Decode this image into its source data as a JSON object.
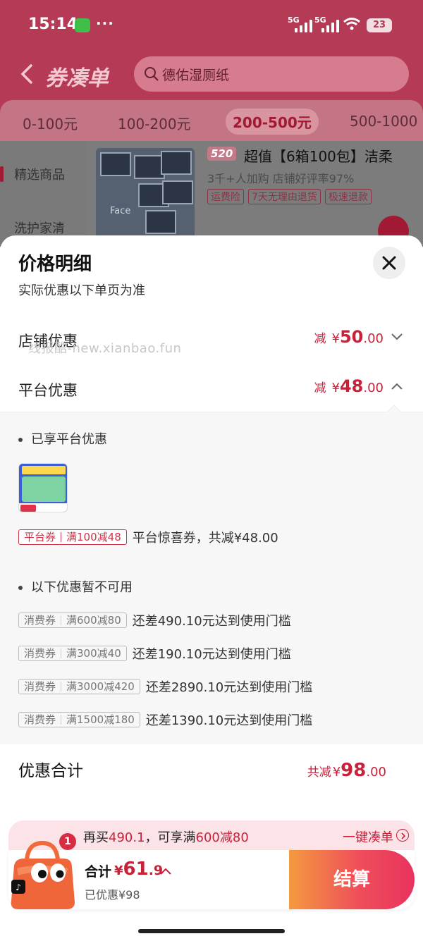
{
  "status_bar": {
    "time": "15:14",
    "net1": "5G",
    "net2": "5G",
    "battery": "23"
  },
  "nav": {
    "title": "券凑单",
    "search_value": "德佑湿厕纸"
  },
  "price_tabs": [
    "0-100元",
    "100-200元",
    "200-500元",
    "500-1000"
  ],
  "active_tab_index": 2,
  "side_nav": [
    "精选商品",
    "洗护家清"
  ],
  "product": {
    "tag": "520",
    "title": "超值【6箱100包】洁柔",
    "sub": "3千+人加购   店铺好评率97%",
    "badges": [
      "运费险",
      "7天无理由退货",
      "极速退款"
    ],
    "image_text": "Face"
  },
  "sheet": {
    "title": "价格明细",
    "subtitle": "实际优惠以下单页为准",
    "watermark": "线报酷-new.xianbao.fun",
    "store_discount": {
      "label": "店铺优惠",
      "minus": "减",
      "yen": "¥",
      "int": "50",
      "dec": ".00"
    },
    "platform_discount": {
      "label": "平台优惠",
      "minus": "减",
      "yen": "¥",
      "int": "48",
      "dec": ".00"
    },
    "enjoyed_head": "已享平台优惠",
    "applied_coupon": {
      "type": "平台券",
      "rule": "满100减48",
      "desc": "平台惊喜券，共减¥48.00"
    },
    "unavailable_head": "以下优惠暂不可用",
    "unavailable_coupons": [
      {
        "type": "消费券",
        "rule": "满600减80",
        "desc": "还差490.10元达到使用门槛"
      },
      {
        "type": "消费券",
        "rule": "满300减40",
        "desc": "还差190.10元达到使用门槛"
      },
      {
        "type": "消费券",
        "rule": "满3000减420",
        "desc": "还差2890.10元达到使用门槛"
      },
      {
        "type": "消费券",
        "rule": "满1500减180",
        "desc": "还差1390.10元达到使用门槛"
      }
    ],
    "total": {
      "label": "优惠合计",
      "prefix": "共减",
      "yen": "¥",
      "int": "98",
      "dec": ".00"
    }
  },
  "promo": {
    "part1": "再买",
    "amount": "490.1",
    "part2": "，可享满",
    "threshold": "600减80",
    "link": "一键凑单"
  },
  "checkout": {
    "badge": "1",
    "total_label": "合计",
    "yen": "¥",
    "int": "61",
    "dec": ".9",
    "saved": "已优惠¥98",
    "pay_label": "结算"
  },
  "colors": {
    "accent": "#c8213a",
    "bg_dim": "#b43a56"
  }
}
